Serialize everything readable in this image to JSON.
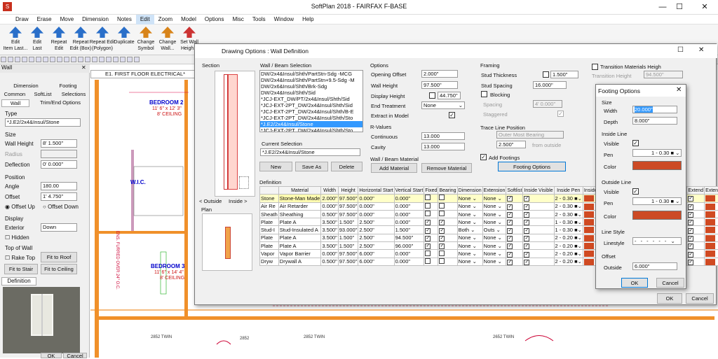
{
  "app": {
    "title": "SoftPlan 2018 - FAIRFAX F-BASE"
  },
  "menu": [
    "Draw",
    "Erase",
    "Move",
    "Dimension",
    "Notes",
    "Edit",
    "Zoom",
    "Model",
    "Options",
    "Misc",
    "Tools",
    "Window",
    "Help"
  ],
  "menu_active": "Edit",
  "ribbon": [
    {
      "label": "Edit",
      "label2": "Item Last..."
    },
    {
      "label": "Edit",
      "label2": "Last"
    },
    {
      "label": "Repeat",
      "label2": "Edit"
    },
    {
      "label": "Repeat",
      "label2": "Edit (Box)"
    },
    {
      "label": "Repeat Edit",
      "label2": "(Polygon)"
    },
    {
      "label": "Duplicate",
      "label2": ""
    },
    {
      "label": "Change",
      "label2": "Symbol"
    },
    {
      "label": "Change",
      "label2": "Wall..."
    },
    {
      "label": "Set Wall",
      "label2": "Heigh..."
    }
  ],
  "doc_tab": "E1. FIRST FLOOR ELECTRICAL*",
  "left": {
    "header": "Wall",
    "tabs1": [
      "Dimension",
      "Footing"
    ],
    "tabs2": [
      "Common",
      "SoftList",
      "Selections"
    ],
    "tabs3": [
      "Wall",
      "Trim/End Options"
    ],
    "type_label": "Type",
    "type_value": "*J.E2/2x4&Insul/Stone",
    "size_label": "Size",
    "wall_height_label": "Wall Height",
    "wall_height": "8' 1.500\"",
    "radius_label": "Radius",
    "deflection_label": "Deflection",
    "deflection": "0' 0.000\"",
    "position_label": "Position",
    "angle_label": "Angle",
    "angle": "180.00",
    "offset_label": "Offset",
    "offset": "1' 4.750\"",
    "offset_up": "Offset Up",
    "offset_down": "Offset Down",
    "display_label": "Display",
    "exterior_label": "Exterior",
    "exterior": "Down",
    "hidden_label": "Hidden",
    "top_of_wall": "Top of Wall",
    "rake_top": "Rake Top",
    "fit_roof": "Fit to Roof",
    "fit_stair": "Fit to Stair",
    "fit_ceiling": "Fit to Ceiling",
    "definition_tab": "Definition",
    "ok": "OK",
    "cancel": "Cancel"
  },
  "plan": {
    "rooms": [
      {
        "name": "BEDROOM 2",
        "size": "11' 6\" x 12' 3\"",
        "ceiling": "8' CEILING"
      },
      {
        "name": "BEDROOM 3",
        "size": "11' 6\" x 14' 4\"",
        "ceiling": "8' CEILING"
      },
      {
        "name": "W.I.C.",
        "size": "",
        "ceiling": ""
      }
    ],
    "notes": [
      "ENS. FURRED OVER 24\" O.C.",
      "2852 TWIN",
      "2852",
      "2852 TWIN",
      "2652 TWIN"
    ]
  },
  "dialog": {
    "title": "Drawing Options : Wall Definition",
    "section_label": "Section",
    "view_outside": "< Outside",
    "view_inside": "Inside >",
    "plan_label": "Plan",
    "wb_selection_label": "Wall / Beam Selection",
    "wb_list": [
      "DW/2x4&Insul/Shth/PartStn-Sdg -MCG",
      "DW/2x4&Insul/Shth/PartStn+9.5-Sdg -M",
      "DW/2x6&Insul/Shth/Brk-Sdg",
      "DW/2x4&Insul/Shth/Sid",
      "*JCJ-EXT_DW/PT/2x4&Insul/Shth/Sid",
      "*JCJ-EXT-2PT_DW/2x4&Insul/Shth/Sid",
      "*JCJ-EXT-2PT_DW/2x4&Insul/Shth/B-E",
      "*JCJ-EXT-2PT_DW/2x4&Insul/Shth/Sto",
      "*J.E2/2x4&Insul/Stone",
      "*JCJ-EXT-2PT_DW/2x4&Insul/Shth/Sto"
    ],
    "wb_selected_index": 8,
    "current_selection_label": "Current Selection",
    "current_selection": "*J.E2/2x4&Insul/Stone",
    "new": "New",
    "save_as": "Save As",
    "delete": "Delete",
    "options_label": "Options",
    "opening_offset_label": "Opening Offset",
    "opening_offset": "2.000\"",
    "wall_height_label": "Wall Height",
    "wall_height": "97.500\"",
    "display_height_label": "Display Height",
    "display_height": "44.750\"",
    "end_treatment_label": "End Treatment",
    "end_treatment": "None",
    "extract_label": "Extract in Model",
    "rvalues_label": "R-Values",
    "continuous_label": "Continuous",
    "continuous": "13.000",
    "cavity_label": "Cavity",
    "cavity": "13.000",
    "wb_material_label": "Wall / Beam Material",
    "add_material": "Add Material",
    "remove_material": "Remove Material",
    "framing_label": "Framing",
    "stud_thickness_label": "Stud Thickness",
    "stud_thickness": "1.500\"",
    "stud_spacing_label": "Stud Spacing",
    "stud_spacing": "16.000\"",
    "blocking_label": "Blocking",
    "spacing_label": "Spacing",
    "spacing": "4' 0.000\"",
    "staggered_label": "Staggered",
    "trace_label": "Trace Line Position",
    "trace_value": "Outer Most Bearing",
    "trace_offset": "2.500\"",
    "from_outside": "from outside",
    "add_footings": "Add Footings",
    "footing_options": "Footing Options",
    "transition_label": "Transition Materials Heigh",
    "transition_height_label": "Transition Height",
    "transition_height": "94.500\"",
    "definition_label": "Definition",
    "ok": "OK",
    "cancel": "Cancel",
    "columns": [
      "",
      "Material",
      "Width",
      "Height",
      "Horizontal Start",
      "Vertical Start",
      "Fixed",
      "Bearing",
      "Dimension",
      "Extension",
      "Softlist",
      "Inside Visible",
      "Inside Pen",
      "Inside Color",
      "Outside Visible",
      "Outside Pen",
      "",
      "Extend",
      "Extend Color"
    ],
    "rows": [
      {
        "type": "Stone",
        "material": "Stone-Man Made",
        "width": "2.000\"",
        "height": "97.500\"",
        "hstart": "0.000\"",
        "vstart": "0.000\"",
        "dim": "None",
        "ext": "None",
        "pen": "2 - 0.30"
      },
      {
        "type": "Air Re",
        "material": "Air Retarder",
        "width": "0.000\"",
        "height": "97.500\"",
        "hstart": "0.000\"",
        "vstart": "0.000\"",
        "dim": "None",
        "ext": "None",
        "pen": "2 - 0.30"
      },
      {
        "type": "Sheath",
        "material": "Sheathing",
        "width": "0.500\"",
        "height": "97.500\"",
        "hstart": "0.000\"",
        "vstart": "0.000\"",
        "dim": "None",
        "ext": "None",
        "pen": "2 - 0.30"
      },
      {
        "type": "Plate",
        "material": "Plate A",
        "width": "3.500\"",
        "height": "1.500\"",
        "hstart": "2.500\"",
        "vstart": "0.000\"",
        "dim": "None",
        "ext": "None",
        "pen": "1 - 0.30"
      },
      {
        "type": "Stud-I",
        "material": "Stud-Insulated A",
        "width": "3.500\"",
        "height": "93.000\"",
        "hstart": "2.500\"",
        "vstart": "1.500\"",
        "dim": "Both",
        "ext": "Outs",
        "pen": "1 - 0.30"
      },
      {
        "type": "Plate",
        "material": "Plate A",
        "width": "3.500\"",
        "height": "1.500\"",
        "hstart": "2.500\"",
        "vstart": "94.500\"",
        "dim": "None",
        "ext": "None",
        "pen": "2 - 0.20"
      },
      {
        "type": "Plate",
        "material": "Plate A",
        "width": "3.500\"",
        "height": "1.500\"",
        "hstart": "2.500\"",
        "vstart": "96.000\"",
        "dim": "None",
        "ext": "None",
        "pen": "2 - 0.20"
      },
      {
        "type": "Vapor",
        "material": "Vapor Barrier",
        "width": "0.000\"",
        "height": "97.500\"",
        "hstart": "6.000\"",
        "vstart": "0.000\"",
        "dim": "None",
        "ext": "None",
        "pen": "2 - 0.20"
      },
      {
        "type": "Dryw",
        "material": "Drywall A",
        "width": "0.500\"",
        "height": "97.500\"",
        "hstart": "6.000\"",
        "vstart": "0.000\"",
        "dim": "None",
        "ext": "None",
        "pen": "2 - 0.20"
      }
    ]
  },
  "footing": {
    "title": "Footing Options",
    "size_label": "Size",
    "width_label": "Width",
    "width": "20.000\"",
    "depth_label": "Depth",
    "depth": "8.000\"",
    "inside_line": "Inside Line",
    "visible": "Visible",
    "pen": "Pen",
    "color": "Color",
    "inside_pen": "1 - 0.30",
    "outside_line": "Outside Line",
    "outside_pen": "1 - 0.30",
    "line_style": "Line Style",
    "linestyle": "Linestyle",
    "offset_label": "Offset",
    "outside_label": "Outside",
    "outside": "6.000\"",
    "ok": "OK",
    "cancel": "Cancel",
    "color_value": "#cc4a25"
  }
}
